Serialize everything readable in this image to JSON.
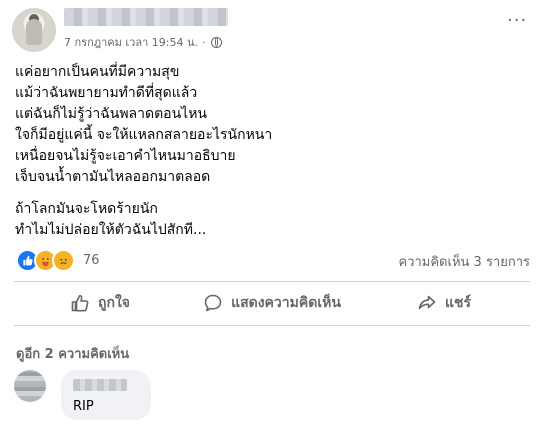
{
  "post": {
    "date": "7 กรกฎาคม เวลา 19:54 น.",
    "separator": "·",
    "lines_group1": [
      "แค่อยากเป็นคนที่มีความสุข",
      "แม้ว่าฉันพยายามทำดีที่สุดแล้ว",
      "แต่ฉันก็ไม่รู้ว่าฉันพลาดตอนไหน",
      "ใจก็มีอยู่แค่นี้ จะให้แหลกสลายอะไรนักหนา",
      "เหนื่อยจนไม่รู้จะเอาคำไหนมาอธิบาย",
      "เจ็บจนน้ำตามันไหลออกมาตลอด"
    ],
    "lines_group2": [
      "ถ้าโลกมันจะโหดร้ายนัก",
      "ทำไมไม่ปล่อยให้ตัวฉันไปสักที..."
    ],
    "more_label": "···"
  },
  "stats": {
    "reaction_count": "76",
    "comments_label": "ความคิดเห็น 3 รายการ",
    "reaction_icons": [
      "like-icon",
      "care-icon",
      "sad-icon"
    ]
  },
  "actions": {
    "like_label": "ถูกใจ",
    "comment_label": "แสดงความคิดเห็น",
    "share_label": "แชร์"
  },
  "comments": {
    "view_more_label": "ดูอีก 2 ความคิดเห็น",
    "items": [
      {
        "text": "RIP"
      }
    ]
  },
  "colors": {
    "secondary_text": "#65676b",
    "primary_text": "#050505",
    "like_blue": "#1877f2",
    "bubble_bg": "#f0f2f5"
  }
}
